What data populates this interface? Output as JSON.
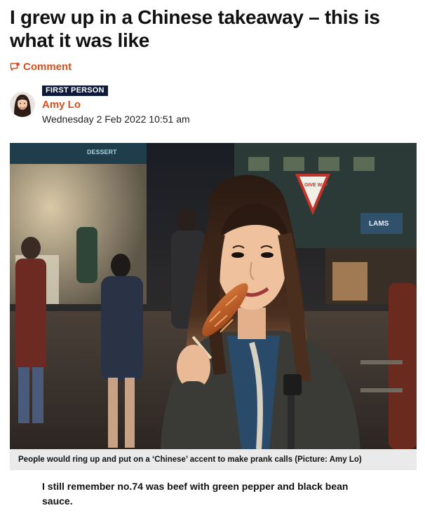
{
  "article": {
    "headline": "I grew up in a Chinese takeaway – this is what it was like",
    "comment_label": "Comment",
    "comment_icon": "speech-bubble-icon",
    "category_badge": "FIRST PERSON",
    "author": "Amy Lo",
    "date": "Wednesday 2 Feb 2022 10:51 am",
    "photo": {
      "sign_give_way": "GIVE WAY",
      "sign_dessert": "DESSERT",
      "sign_lams": "LAMS"
    },
    "caption": "People would ring up and put on a ‘Chinese’ accent to make prank calls (Picture: Amy Lo)",
    "first_paragraph": "I still remember no.74 was beef with green pepper and black bean sauce."
  },
  "colors": {
    "accent": "#d1501c",
    "badge_bg": "#0f1a3a",
    "caption_bg": "#eaeaea"
  }
}
